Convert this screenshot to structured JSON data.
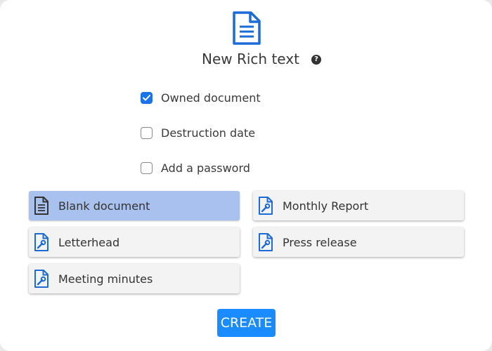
{
  "dialog": {
    "title": "New Rich text",
    "header_icon": "document-icon",
    "help_icon": "question-circle-icon",
    "help_glyph": "?"
  },
  "options": [
    {
      "label": "Owned document",
      "checked": true
    },
    {
      "label": "Destruction date",
      "checked": false
    },
    {
      "label": "Add a password",
      "checked": false
    }
  ],
  "templates": [
    {
      "label": "Blank document",
      "icon": "document-lines-icon",
      "selected": true
    },
    {
      "label": "Monthly Report",
      "icon": "document-wrench-icon",
      "selected": false
    },
    {
      "label": "Letterhead",
      "icon": "document-wrench-icon",
      "selected": false
    },
    {
      "label": "Press release",
      "icon": "document-wrench-icon",
      "selected": false
    },
    {
      "label": "Meeting minutes",
      "icon": "document-wrench-icon",
      "selected": false
    }
  ],
  "create_button": {
    "label": "CREATE"
  },
  "colors": {
    "accent": "#1a73e8",
    "button": "#1a8cff",
    "selected_template": "#a9c1ee",
    "icon_blue": "#1c6bd6",
    "icon_dark": "#333333"
  }
}
